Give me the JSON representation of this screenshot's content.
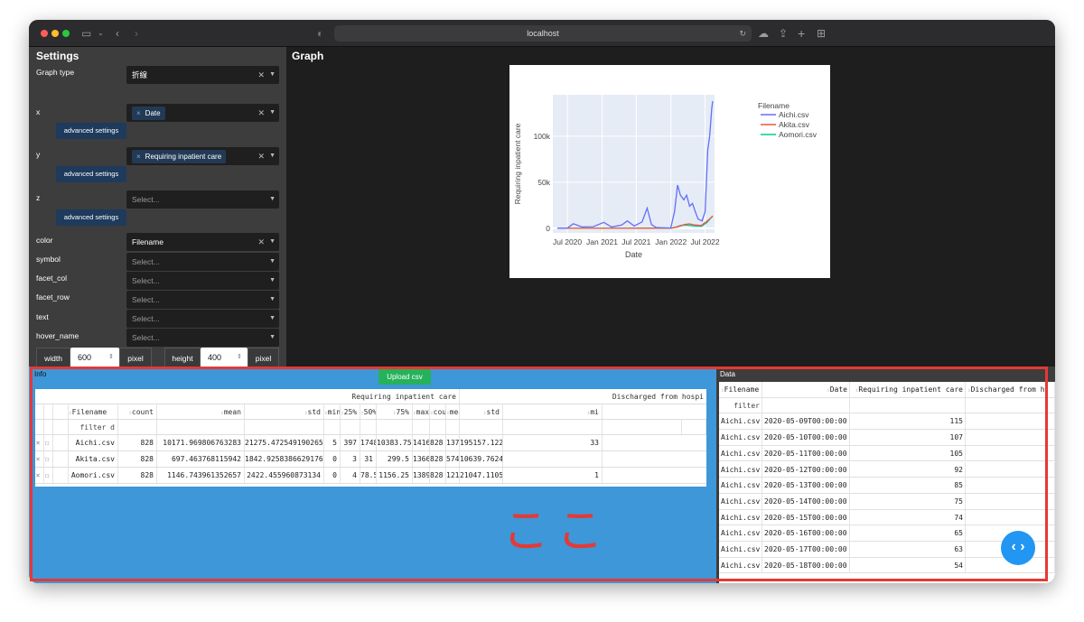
{
  "browser": {
    "url": "localhost"
  },
  "settings": {
    "title": "Settings",
    "graph_type": {
      "label": "Graph type",
      "value": "折線"
    },
    "x": {
      "label": "x",
      "value": "Date"
    },
    "y": {
      "label": "y",
      "value": "Requiring inpatient care"
    },
    "z": {
      "label": "z",
      "placeholder": "Select..."
    },
    "advanced_label": "advanced settings",
    "color": {
      "label": "color",
      "value": "Filename"
    },
    "symbol": {
      "label": "symbol",
      "placeholder": "Select..."
    },
    "facet_col": {
      "label": "facet_col",
      "placeholder": "Select..."
    },
    "facet_row": {
      "label": "facet_row",
      "placeholder": "Select..."
    },
    "text": {
      "label": "text",
      "placeholder": "Select..."
    },
    "hover_name": {
      "label": "hover_name",
      "placeholder": "Select..."
    },
    "width_label": "width",
    "width_value": "600",
    "height_label": "height",
    "height_value": "400",
    "pixel_label": "pixel"
  },
  "graph": {
    "title": "Graph"
  },
  "chart_data": {
    "type": "line",
    "title": "",
    "xlabel": "Date",
    "ylabel": "Requiring inpatient care",
    "x_ticks": [
      "Jul 2020",
      "Jan 2021",
      "Jul 2021",
      "Jan 2022",
      "Jul 2022"
    ],
    "y_ticks": [
      "0",
      "50k",
      "100k"
    ],
    "ylim": [
      -5000,
      145000
    ],
    "legend_title": "Filename",
    "legend_position": "top-right",
    "series": [
      {
        "name": "Aichi.csv",
        "color": "#636efa",
        "x": [
          "2020-05-09",
          "2020-07-01",
          "2020-08-01",
          "2020-09-15",
          "2020-11-15",
          "2021-01-10",
          "2021-02-20",
          "2021-04-15",
          "2021-05-15",
          "2021-06-20",
          "2021-08-01",
          "2021-08-28",
          "2021-09-20",
          "2021-10-15",
          "2021-12-31",
          "2022-01-20",
          "2022-02-05",
          "2022-02-20",
          "2022-03-10",
          "2022-03-25",
          "2022-04-10",
          "2022-04-25",
          "2022-05-10",
          "2022-05-25",
          "2022-06-15",
          "2022-07-01",
          "2022-07-15",
          "2022-07-25",
          "2022-08-05",
          "2022-08-10"
        ],
        "values": [
          115,
          200,
          5000,
          1500,
          1800,
          6500,
          1500,
          3500,
          8000,
          2500,
          7000,
          22000,
          4000,
          900,
          300,
          18000,
          47000,
          36000,
          31000,
          36000,
          24000,
          27000,
          18000,
          10000,
          8000,
          18000,
          85000,
          100000,
          130000,
          138000
        ]
      },
      {
        "name": "Akita.csv",
        "color": "#ef553b",
        "x": [
          "2020-05-09",
          "2021-06-01",
          "2021-09-01",
          "2021-12-31",
          "2022-01-30",
          "2022-02-20",
          "2022-03-15",
          "2022-04-10",
          "2022-05-01",
          "2022-06-10",
          "2022-07-10",
          "2022-08-10"
        ],
        "values": [
          0,
          30,
          60,
          20,
          1200,
          2500,
          4200,
          4800,
          3800,
          3000,
          7500,
          13000
        ]
      },
      {
        "name": "Aomori.csv",
        "color": "#00cc96",
        "x": [
          "2020-05-09",
          "2021-06-01",
          "2021-09-01",
          "2021-12-31",
          "2022-01-30",
          "2022-02-20",
          "2022-03-15",
          "2022-04-10",
          "2022-05-01",
          "2022-06-10",
          "2022-07-10",
          "2022-08-10"
        ],
        "values": [
          0,
          50,
          250,
          30,
          1500,
          3000,
          3600,
          3200,
          2600,
          2200,
          6000,
          13500
        ]
      }
    ]
  },
  "info": {
    "title": "Info",
    "upload_label": "Upload csv",
    "group1": "Requiring inpatient care",
    "group2": "Discharged from hospi",
    "columns": [
      "Filename",
      "count",
      "mean",
      "std",
      "min",
      "25%",
      "50%",
      "75%",
      "max",
      "count",
      "mean",
      "std",
      "mi"
    ],
    "filter_placeholder": "filter d",
    "rows": [
      [
        "Aichi.csv",
        "828",
        "10171.969806763283",
        "21275.472549190265",
        "5",
        "397",
        "1748.5",
        "10383.75",
        "141689",
        "828",
        "137979.28743961352",
        "195157.12254670105",
        "33"
      ],
      [
        "Akita.csv",
        "828",
        "697.463768115942",
        "1842.9258386629176",
        "0",
        "3",
        "31",
        "299.5",
        "13664",
        "828",
        "5742.952898550725",
        "10639.762470821684",
        ""
      ],
      [
        "Aomori.csv",
        "828",
        "1146.743961352657",
        "2422.455960873134",
        "0",
        "4",
        "78.5",
        "1156.25",
        "13895",
        "828",
        "12103.786231884058",
        "21047.11053869411",
        "1"
      ]
    ],
    "annotation": "ここ"
  },
  "data": {
    "title": "Data",
    "columns": [
      "Filename",
      "Date",
      "Requiring inpatient care",
      "Discharged from h"
    ],
    "filter_placeholder": "filter",
    "rows": [
      [
        "Aichi.csv",
        "2020-05-09T00:00:00",
        "115"
      ],
      [
        "Aichi.csv",
        "2020-05-10T00:00:00",
        "107"
      ],
      [
        "Aichi.csv",
        "2020-05-11T00:00:00",
        "105"
      ],
      [
        "Aichi.csv",
        "2020-05-12T00:00:00",
        "92"
      ],
      [
        "Aichi.csv",
        "2020-05-13T00:00:00",
        "85"
      ],
      [
        "Aichi.csv",
        "2020-05-14T00:00:00",
        "75"
      ],
      [
        "Aichi.csv",
        "2020-05-15T00:00:00",
        "74"
      ],
      [
        "Aichi.csv",
        "2020-05-16T00:00:00",
        "65"
      ],
      [
        "Aichi.csv",
        "2020-05-17T00:00:00",
        "63"
      ],
      [
        "Aichi.csv",
        "2020-05-18T00:00:00",
        "54"
      ]
    ]
  }
}
